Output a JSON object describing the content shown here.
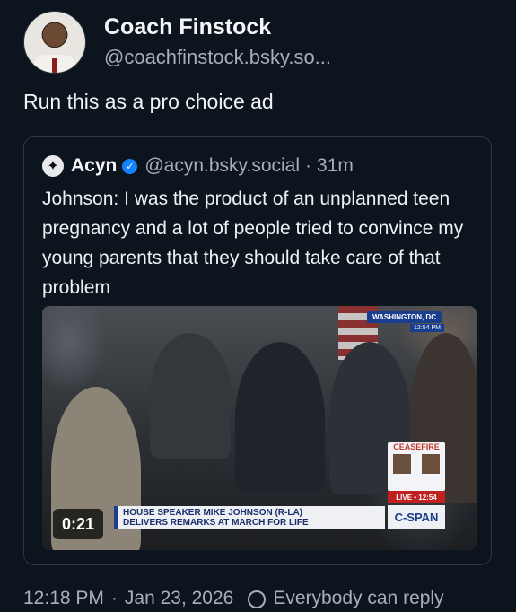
{
  "post": {
    "author_name": "Coach Finstock",
    "author_handle": "@coachfinstock.bsky.so...",
    "text": "Run this as a pro choice ad",
    "timestamp": "12:18 PM",
    "date": "Jan 23, 2026",
    "reply_setting": "Everybody can reply"
  },
  "quote": {
    "author_name": "Acyn",
    "author_handle": "@acyn.bsky.social",
    "time_ago": "31m",
    "text": "Johnson: I was the product of an unplanned teen pregnancy and a lot of people tried to convince my young parents that they should take care of that problem",
    "video": {
      "duration": "0:21",
      "location_badge": "WASHINGTON, DC",
      "location_time": "12:54 PM",
      "chyron_line1": "HOUSE SPEAKER MIKE JOHNSON (R-LA)",
      "chyron_line2": "DELIVERS REMARKS AT MARCH FOR LIFE",
      "network": "C-SPAN",
      "live_label": "LIVE • 12:54",
      "side_graphic_word": "CEASEFIRE"
    }
  },
  "colors": {
    "background": "#0c141d",
    "text_primary": "#f1f3f5",
    "text_secondary": "#a7b0b9",
    "verified_badge": "#1083fe",
    "quote_border": "#2a3743"
  },
  "icons": {
    "verified": "verified-check-icon",
    "reply": "reply-settings-icon"
  }
}
